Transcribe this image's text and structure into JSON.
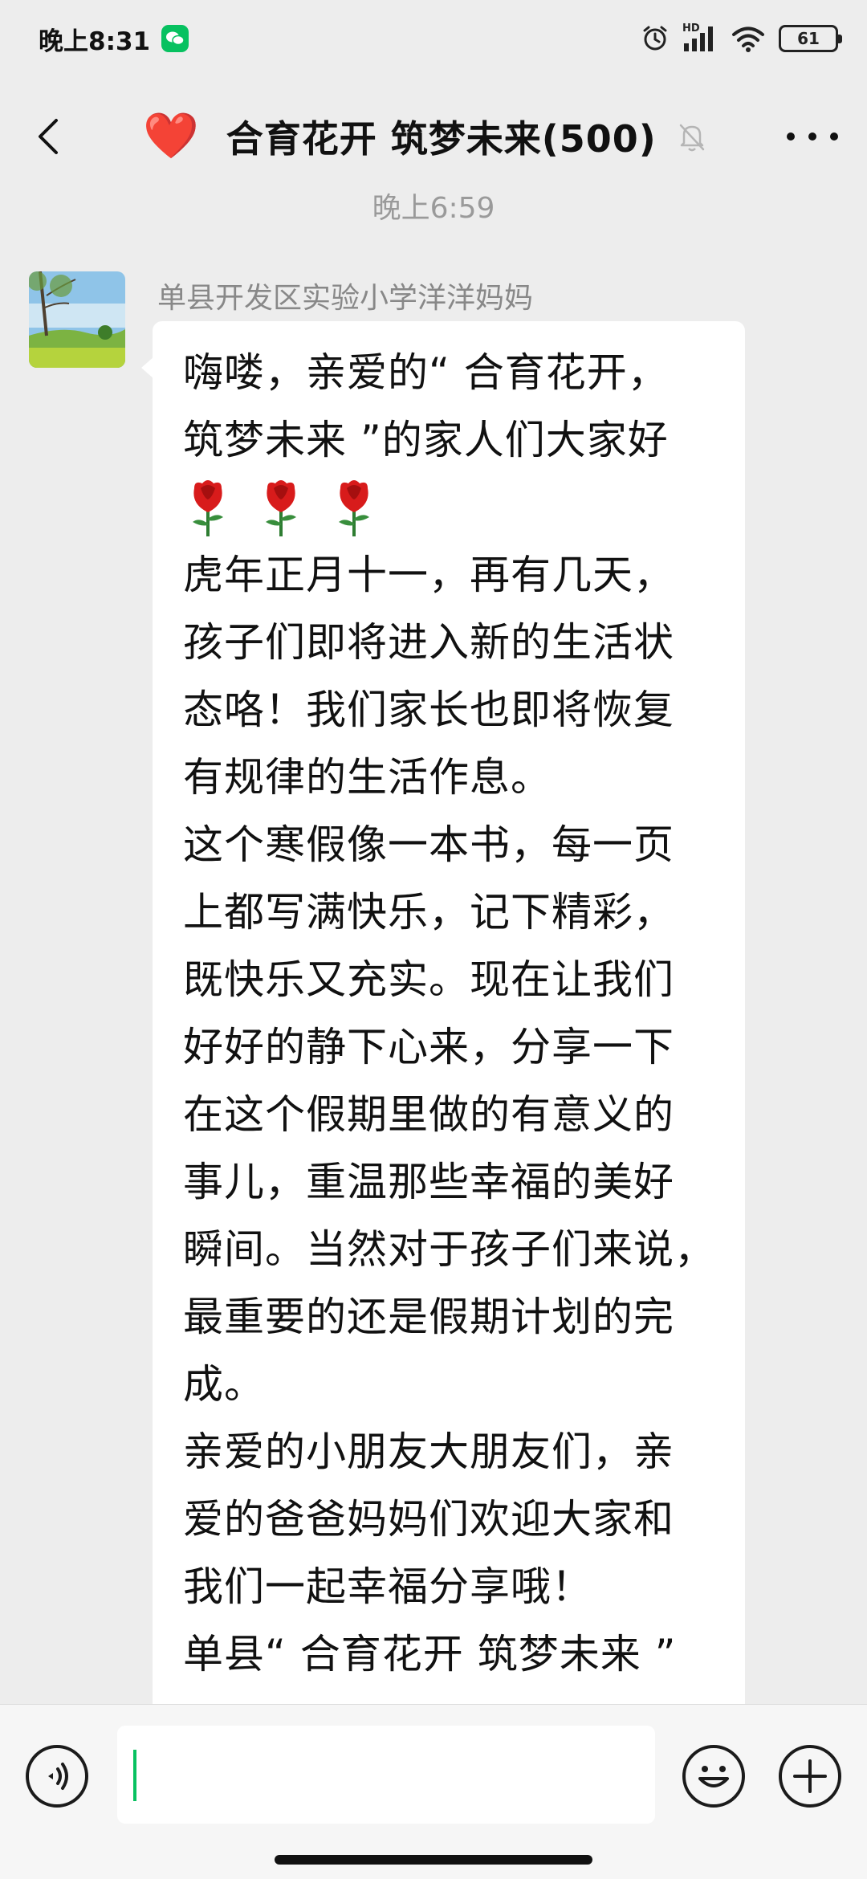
{
  "status_bar": {
    "time": "晚上8:31",
    "battery": "61",
    "network": "HD"
  },
  "chat": {
    "title": "合育花开 筑梦未来(500)",
    "title_emoji": "❤️",
    "timestamp": "晚上6:59"
  },
  "message": {
    "sender": "单县开发区实验小学洋洋妈妈",
    "lines": [
      "嗨喽，亲爱的“ 合育花开，",
      "筑梦未来 ”的家人们大家好",
      "",
      "虎年正月十一，再有几天，",
      "孩子们即将进入新的生活状",
      "态咯！我们家长也即将恢复",
      "有规律的生活作息。",
      "这个寒假像一本书，每一页",
      "上都写满快乐，记下精彩，",
      "既快乐又充实。现在让我们",
      "好好的静下心来，分享一下",
      "在这个假期里做的有意义的",
      "事儿，重温那些幸福的美好",
      "瞬间。当然对于孩子们来说，",
      "最重要的还是假期计划的完",
      "成。",
      "亲爱的小朋友大朋友们，亲",
      "爱的爸爸妈妈们欢迎大家和",
      "我们一起幸福分享哦！",
      "单县“ 合育花开  筑梦未来 ”"
    ],
    "rose_count": 3
  },
  "colors": {
    "background": "#ededed",
    "bubble": "#ffffff",
    "accent": "#07c160",
    "heart": "#e0161f"
  },
  "icons": [
    "back-icon",
    "heart-icon",
    "mute-icon",
    "more-icon",
    "voice-icon",
    "emoji-icon",
    "plus-icon",
    "rose-icon"
  ]
}
